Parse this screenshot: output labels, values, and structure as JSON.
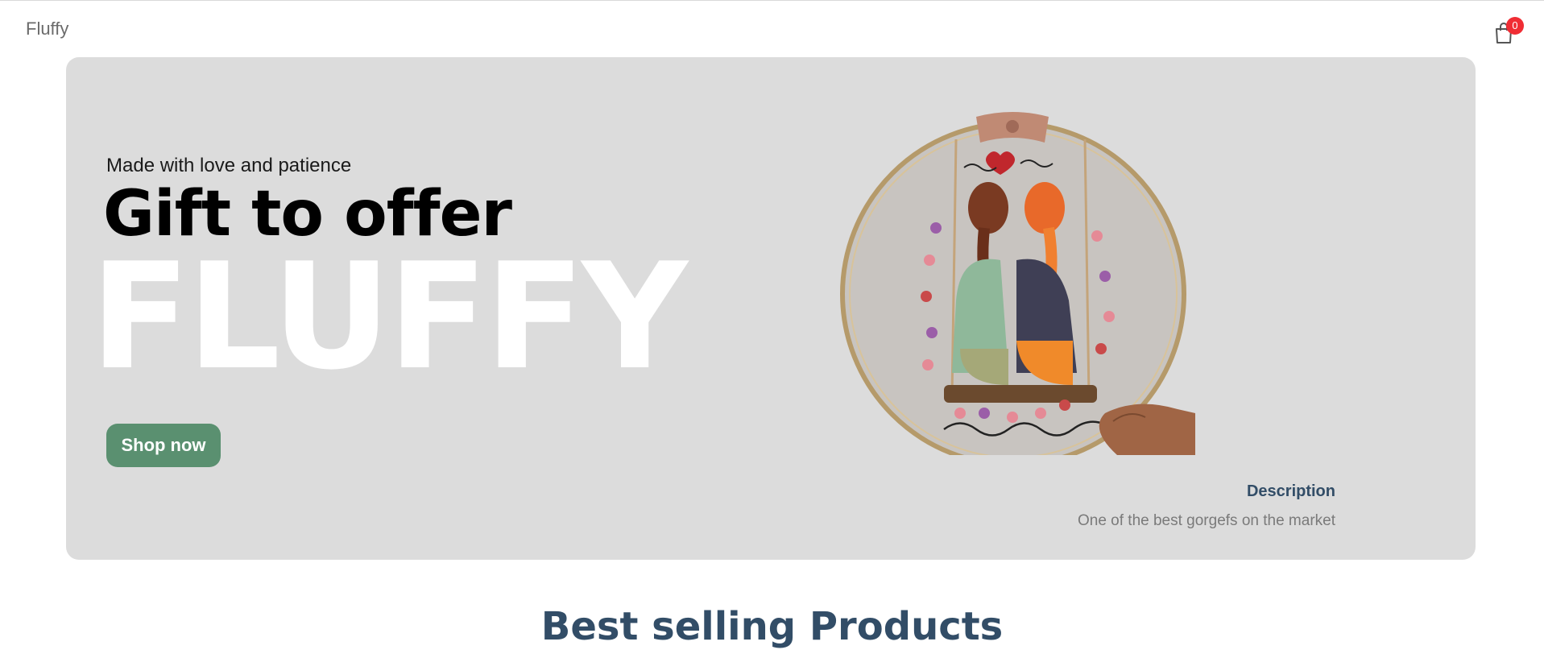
{
  "navbar": {
    "logo": "Fluffy",
    "cart_count": "0"
  },
  "hero": {
    "small_text": "Made with love and patience",
    "mid_text": "Gift to offer",
    "large_text": "FLUFFY",
    "button_label": "Shop now",
    "image_alt": "Embroidery hoop with two girls on a swing",
    "description_title": "Description",
    "description_text": "One of the best gorgefs on the market"
  },
  "sections": {
    "best_selling_title": "Best selling Products"
  },
  "colors": {
    "hero_bg": "#dcdcdc",
    "button_bg": "#5a9070",
    "badge_bg": "#f02d34",
    "heading": "#324d67"
  }
}
